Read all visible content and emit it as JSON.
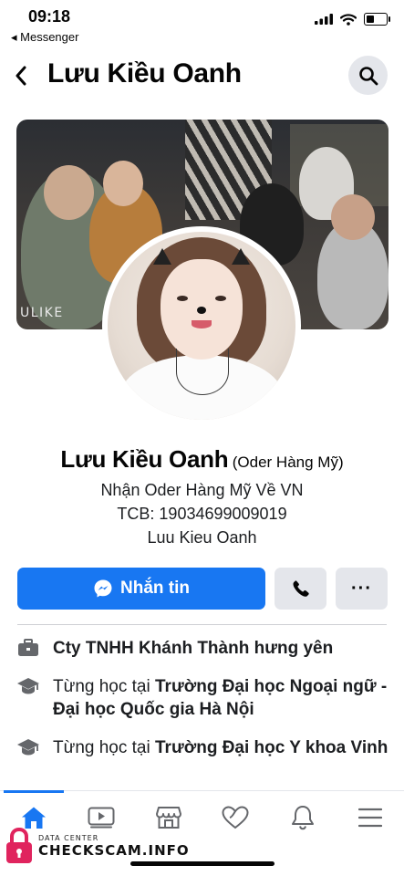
{
  "status_bar": {
    "time": "09:18",
    "back_app": "◂ Messenger"
  },
  "header": {
    "title": "Lưu Kiều Oanh"
  },
  "cover": {
    "watermark": "ULIKE"
  },
  "profile": {
    "name": "Lưu Kiều Oanh",
    "alt_name": "(Oder Hàng Mỹ)",
    "bio_lines": [
      "Nhận Oder Hàng Mỹ Về VN",
      "TCB: 19034699009019",
      "Luu Kieu Oanh"
    ]
  },
  "actions": {
    "message_label": "Nhắn tin",
    "more_label": "···"
  },
  "details": [
    {
      "icon": "briefcase-icon",
      "prefix": "",
      "bold": "Cty TNHH Khánh Thành hưng yên"
    },
    {
      "icon": "graduation-cap-icon",
      "prefix": "Từng học tại ",
      "bold": "Trường Đại học Ngoại ngữ - Đại học Quốc gia Hà Nội"
    },
    {
      "icon": "graduation-cap-icon",
      "prefix": "Từng học tại ",
      "bold": "Trường Đại học Y khoa Vinh"
    }
  ],
  "nav": {
    "tabs": [
      "home-icon",
      "video-icon",
      "marketplace-icon",
      "dating-heart-icon",
      "bell-icon",
      "menu-icon"
    ],
    "active": "home-icon"
  },
  "watermark": {
    "line1": "DATA CENTER",
    "line2": "CHECKSCAM.INFO"
  },
  "colors": {
    "accent": "#1877f2",
    "button_gray": "#e4e6eb",
    "text": "#050505"
  }
}
